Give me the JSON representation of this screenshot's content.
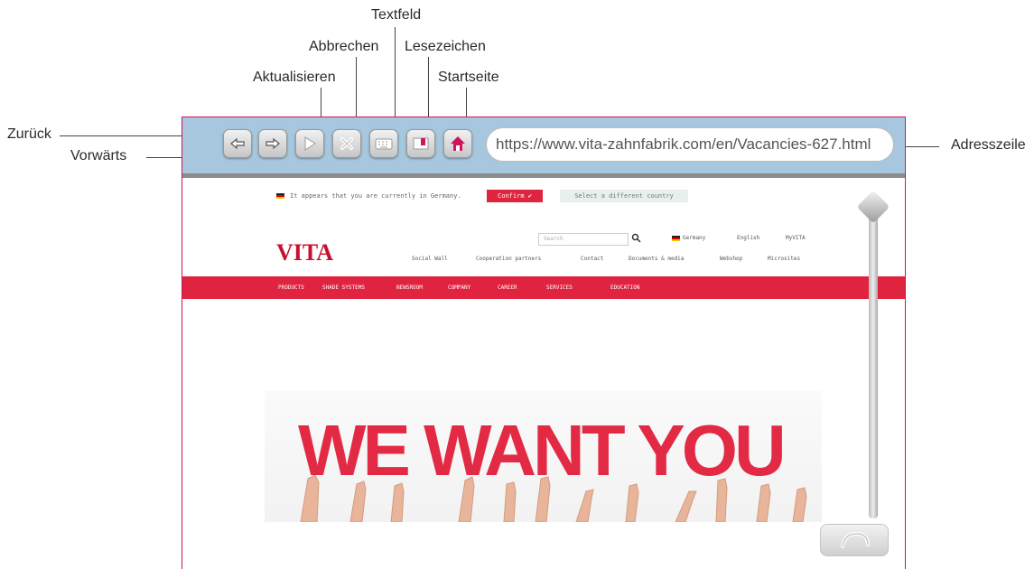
{
  "callouts": {
    "back": "Zurück",
    "forward": "Vorwärts",
    "refresh": "Aktualisieren",
    "cancel": "Abbrechen",
    "textfield": "Textfeld",
    "bookmarks": "Lesezeichen",
    "home": "Startseite",
    "address_bar": "Adresszeile"
  },
  "browser": {
    "url": "https://www.vita-zahnfabrik.com/en/Vacancies-627.html",
    "buttons": [
      "back-arrow-icon",
      "forward-arrow-icon",
      "play-icon",
      "close-x-icon",
      "keyboard-icon",
      "bookmark-icon",
      "home-icon"
    ],
    "accent_color": "#d0155b",
    "toolbar_color": "#a7c7de"
  },
  "site": {
    "geo_notice": "It appears that you are currently in Germany.",
    "confirm_label": "Confirm ✔",
    "select_country_label": "Select a different country",
    "logo": "VITA",
    "search_placeholder": "Search",
    "country": "Germany",
    "language": "English",
    "myvita": "MyVITA",
    "secondary_nav": [
      "Social Wall",
      "Cooperation partners",
      "Contact",
      "Documents & media",
      "Webshop",
      "Microsites"
    ],
    "main_nav": [
      "PRODUCTS",
      "SHADE SYSTEMS",
      "NEWSROOM",
      "COMPANY",
      "CAREER",
      "SERVICES",
      "EDUCATION"
    ],
    "banner_text": "WE WANT YOU",
    "brand_red": "#e0233f"
  }
}
